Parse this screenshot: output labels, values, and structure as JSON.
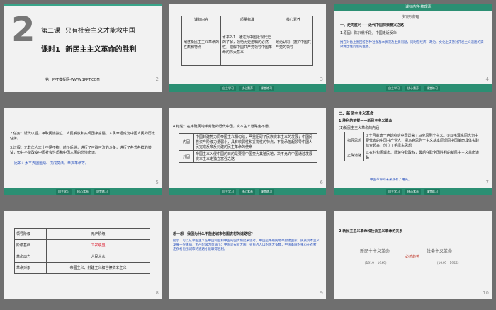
{
  "slides": [
    {
      "num": "2",
      "big_digit": "2",
      "lesson": "第二课",
      "lesson_title": "只有社会主义才能救中国",
      "period": "课时1",
      "period_title": "新民主主义革命的胜利",
      "footer": "第一PPT模板网-WWW.1PPT.COM"
    },
    {
      "num": "3",
      "headers": [
        "课标内容",
        "质量标准",
        "核心素养"
      ],
      "cells": [
        "阐述新民主主义革命的性质和特点",
        "水平2-1　通过对中国近现代史的了解，领悟历史逻辑的必然性，理解中国共产党领导中国革命的伟大意义",
        "政治认同：拥护中国共产党的领导"
      ]
    },
    {
      "num": "4",
      "header_tag": "课标内容·梳理素",
      "tab_a": "自主学习",
      "tab_b": "核心素养",
      "section": "知识梳理",
      "line1": "一、走向胜利——近代中国探索复兴之路",
      "line2": "1.原因：陈兴就手段，中国走近反华",
      "line3": "推在对比上图回答各种社会基本状况及主要问题，同时在经济、政治、文化上支持对开发主义道路的实效做出性反思的准备。"
    },
    {
      "num": "5",
      "line1": "2.任务：近代以后，争取民族独立、人民解放和实现国家富强、人民幸福成为中国人民的历史任务。",
      "line2": "3.过程：无数仁人志士不屈不挠、前仆后继，进行了可歌可泣的斗争，进行了各式各样的尝试，但并不能改变中国社会性质和中国人民的悲惨命运。",
      "note": "比如：太平天国运动、戊戌变法、辛亥革命等。"
    },
    {
      "num": "6",
      "line0": "4.结论：在半殖民地半封建的近代中国，资本主义道路走不通。",
      "row1_label": "内因",
      "row1_text": "中国封建势力同帝国主义相勾结，严重阻碍了民族资本主义的发展；中国民族资产阶级力量弱小，具有软弱性和妥协性的特点，不能承担起领导中国人民完成反帝反封建的民主革命的使命",
      "row2_label": "外因",
      "row2_text": "帝国主义入侵中国的目的是要把中国变为其殖民地，决不允许中国通过发展资本主义走独立富强之路"
    },
    {
      "num": "7",
      "line1": "二、新民主主义革命",
      "line2": "1.胜利的前提——新民主主义革命",
      "line3": "(1)新民主主义革命的内涵",
      "rowA_label": "指导思想",
      "rowA_text": "①十月革命一声炮响给中国送来了马克思列宁主义。②以毛泽东同志为主要代表的中国共产党人，把马克思列宁主义基本原理同中国革命具体实践结合起来，创立了毛泽东思想",
      "rowB_label": "正确道路",
      "rowB_text": "以农村包围城市、武装夺取政权，最后夺取全国胜利的新民主主义革命道路",
      "note": "中国革命的未来就有了曙光。"
    },
    {
      "num": "8",
      "rows": [
        [
          "领导阶级",
          "无产阶级"
        ],
        [
          "阶级基础",
          "工农联盟"
        ],
        [
          "革命动力",
          "人民大众"
        ],
        [
          "革命对象",
          "帝国主义、封建主义和官僚资本主义"
        ]
      ]
    },
    {
      "num": "9",
      "question": "想一想　我国为什么不能走城市包围农村的道路呢？",
      "answer": "提示　可以从帝国主义在中国利益和中国的国情角度来思考。中国是半殖民地半封建国家，民族资本主义发展十分薄弱，无产阶级力量弱小；中国是农业大国，农民占人口的绝大多数，中国革命的重心在农村，走农村包围城市的道路才能取得胜利。"
    },
    {
      "num": "10",
      "line1": "2.新民主主义革命和社会主义革命的关系",
      "left_phase": "新民主主义革命",
      "right_phase": "社会主义革命",
      "middle": "必然趋势",
      "left_years": "（1919—1949）",
      "right_years": "（1949—1956）"
    }
  ],
  "nav": [
    "自主学习",
    "核心素养",
    "课堂练习"
  ]
}
